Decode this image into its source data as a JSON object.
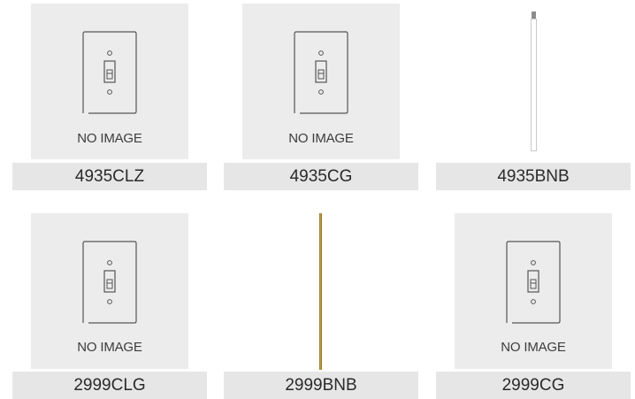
{
  "products": [
    {
      "sku": "4935CLZ",
      "image": "placeholder",
      "placeholder_text": "NO IMAGE",
      "icon": "light-switch-icon"
    },
    {
      "sku": "4935CG",
      "image": "placeholder",
      "placeholder_text": "NO IMAGE",
      "icon": "light-switch-icon"
    },
    {
      "sku": "4935BNB",
      "image": "white-rod",
      "icon": "downrod-icon"
    },
    {
      "sku": "2999CLG",
      "image": "placeholder",
      "placeholder_text": "NO IMAGE",
      "icon": "light-switch-icon"
    },
    {
      "sku": "2999BNB",
      "image": "brass-rod",
      "icon": "downrod-icon"
    },
    {
      "sku": "2999CG",
      "image": "placeholder",
      "placeholder_text": "NO IMAGE",
      "icon": "light-switch-icon"
    }
  ],
  "colors": {
    "placeholder_bg": "#ececec",
    "label_bg": "#e6e6e6",
    "brass_rod": "#b8963e"
  }
}
